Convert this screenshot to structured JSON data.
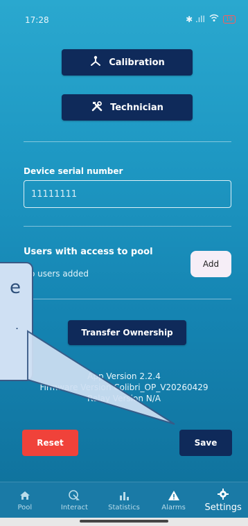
{
  "status_bar": {
    "time": "17:28",
    "signal": "✱ .ıll",
    "wifi": "●",
    "battery": "19"
  },
  "settings": {
    "calibration_label": "Calibration",
    "technician_label": "Technician",
    "serial_label": "Device serial number",
    "serial_value": "11111111",
    "users_label": "Users with access to pool",
    "users_empty": "No users added",
    "add_label": "Add",
    "transfer_label": "Transfer Ownership",
    "app_version": "App Version 2.2.4",
    "firmware_version": "Firmware Version Colibri_OP_V20260429",
    "relay_version": "Relay Version N/A",
    "reset_label": "Reset",
    "save_label": "Save"
  },
  "nav": {
    "items": [
      {
        "label": "Pool",
        "icon": "home-icon"
      },
      {
        "label": "Interact",
        "icon": "interact-icon"
      },
      {
        "label": "Statistics",
        "icon": "statistics-icon"
      },
      {
        "label": "Alarms",
        "icon": "alarm-icon"
      },
      {
        "label": "Settings",
        "icon": "gear-icon"
      }
    ],
    "active": "Settings"
  },
  "overlay": {
    "callout_text_1": "e",
    "callout_text_2": "."
  }
}
